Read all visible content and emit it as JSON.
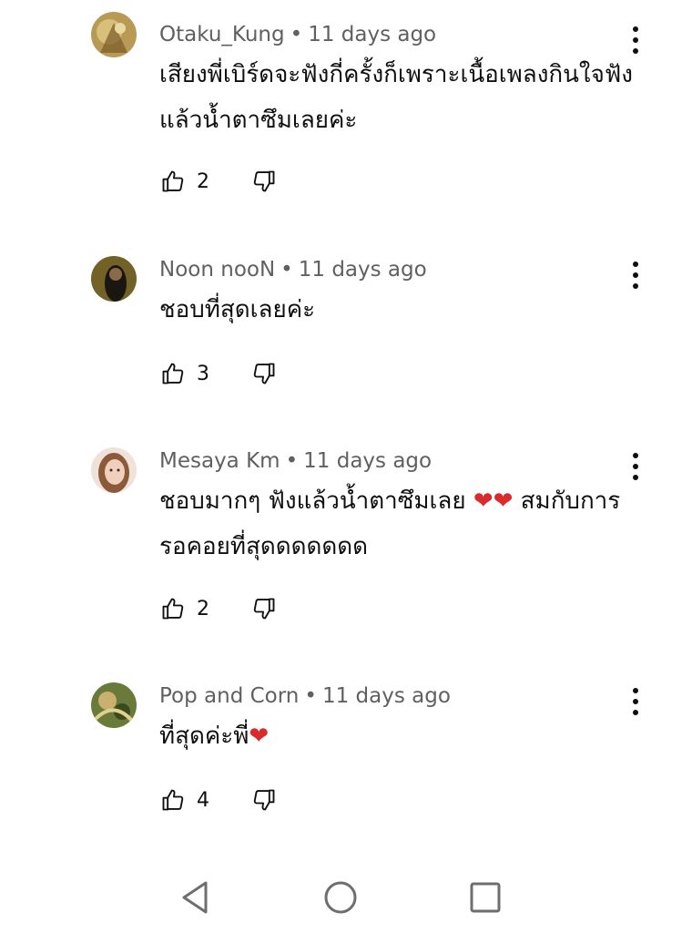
{
  "comments": [
    {
      "author": "Otaku_Kung",
      "time": "11 days ago",
      "text": "เสียงพี่เบิร์ดจะฟังกี่ครั้งก็เพราะเนื้อเพลงกินใจฟังแล้วน้ำตาซึมเลยค่ะ",
      "text_suffix": "",
      "likes": "2",
      "avatar_colors": [
        "#b89a55",
        "#7a5a2a"
      ]
    },
    {
      "author": "Noon nooN",
      "time": "11 days ago",
      "text": "ชอบที่สุดเลยค่ะ",
      "text_suffix": "",
      "likes": "3",
      "avatar_colors": [
        "#2b2b1e",
        "#c9a436"
      ]
    },
    {
      "author": "Mesaya Km",
      "time": "11 days ago",
      "text": "ชอบมากๆ ฟังแล้วน้ำตาซึมเลย ",
      "text_hearts": "❤❤",
      "text_suffix": " สมกับการรอคอยที่สุดดดดดดด",
      "likes": "2",
      "avatar_colors": [
        "#e8c8b8",
        "#8a5a3a"
      ]
    },
    {
      "author": "Pop and Corn",
      "time": "11 days ago",
      "text": "ที่สุดค่ะพี่",
      "text_hearts": "❤",
      "text_suffix": "",
      "likes": "4",
      "avatar_colors": [
        "#6a7a3a",
        "#c9b070"
      ]
    }
  ],
  "separator": "•",
  "colors": {
    "heart": "#d92b2b",
    "meta": "#606060",
    "text": "#0f0f0f",
    "nav_icon": "#6e6e6e"
  },
  "icons": {
    "like": "thumbs-up-icon",
    "dislike": "thumbs-down-icon",
    "menu": "more-vert-icon",
    "nav": [
      "back-triangle-icon",
      "home-circle-icon",
      "recents-square-icon"
    ]
  }
}
